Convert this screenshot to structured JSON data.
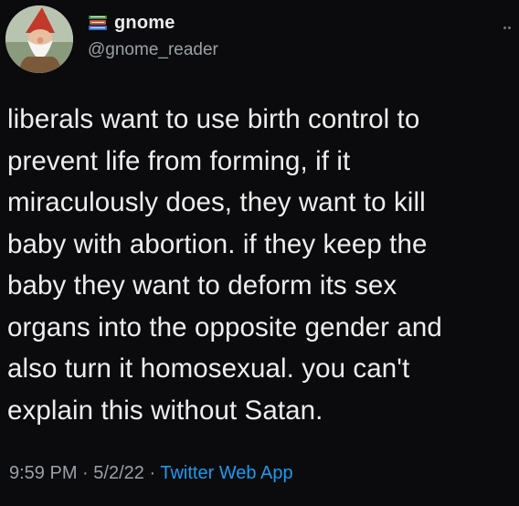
{
  "tweet": {
    "author": {
      "display_name": "gnome",
      "handle": "@gnome_reader",
      "name_emoji_icon": "books-icon",
      "avatar_icon": "gnome-avatar"
    },
    "text": "liberals want to use birth control to\nprevent life from forming, if it\nmiraculously does, they want to kill\nbaby with abortion.  if they keep the\nbaby they want to deform its sex\norgans into the opposite gender and\nalso turn it homosexual.  you can't\nexplain this without Satan.",
    "meta": {
      "time": "9:59 PM",
      "separator": "·",
      "date": "5/2/22",
      "source": "Twitter Web App"
    },
    "more_icon": "more-options-icon"
  },
  "colors": {
    "background": "#0b0b0d",
    "text": "#eeeeee",
    "secondary_text": "#9aa0a6",
    "link": "#1d9bf0"
  }
}
